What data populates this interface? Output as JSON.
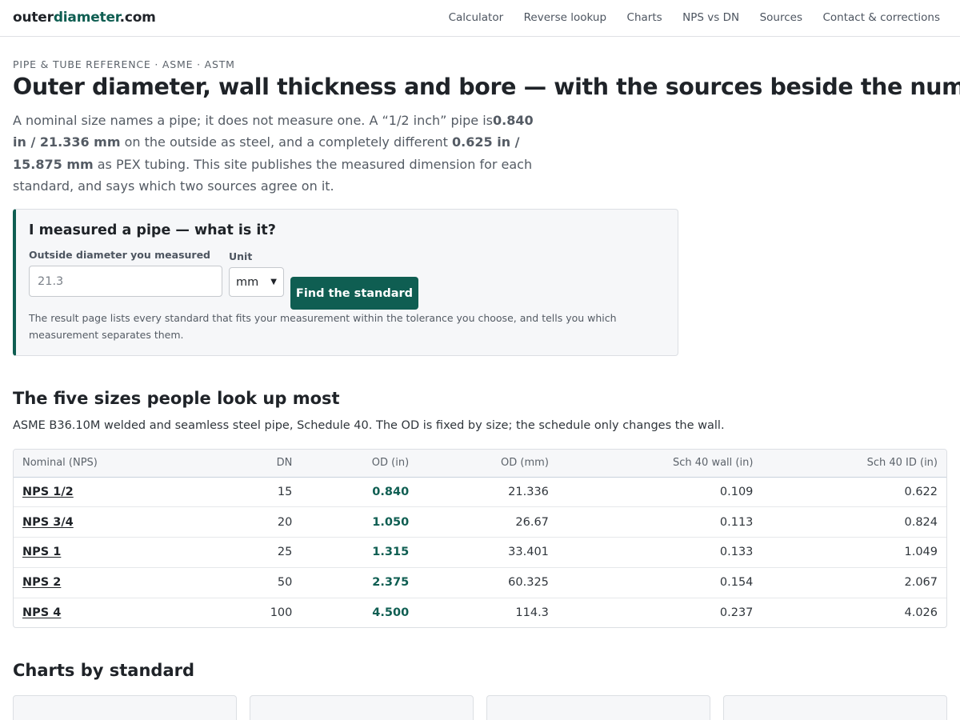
{
  "header": {
    "logo_part1": "outer",
    "logo_part2": "diameter",
    "logo_part3": ".com",
    "nav": [
      "Calculator",
      "Reverse lookup",
      "Charts",
      "NPS vs DN",
      "Sources",
      "Contact & corrections"
    ]
  },
  "intro": {
    "eyebrow": "PIPE & TUBE REFERENCE · ASME · ASTM",
    "title": "Outer diameter, wall thickness and bore — with the sources beside the number",
    "lead_1": "A nominal size names a pipe; it does not measure one. A “1/2 inch” pipe is",
    "lead_b1": "0.840 in / 21.336 mm",
    "lead_2": " on the outside as steel, and a completely different ",
    "lead_b2": "0.625 in / 15.875 mm",
    "lead_3": " as PEX tubing. This site publishes the measured dimension for each standard, and says which two sources agree on it."
  },
  "lookup": {
    "title": "I measured a pipe — what is it?",
    "od_label": "Outside diameter you measured",
    "od_placeholder": "21.3",
    "unit_label": "Unit",
    "unit_value": "mm",
    "button": "Find the standard",
    "help": "The result page lists every standard that fits your measurement within the tolerance you choose, and tells you which measurement separates them."
  },
  "sizes": {
    "heading": "The five sizes people look up most",
    "subtitle": "ASME B36.10M welded and seamless steel pipe, Schedule 40. The OD is fixed by size; the schedule only changes the wall.",
    "columns": [
      "Nominal (NPS)",
      "DN",
      "OD (in)",
      "OD (mm)",
      "Sch 40 wall (in)",
      "Sch 40 ID (in)"
    ],
    "rows": [
      [
        "NPS 1/2",
        "15",
        "0.840",
        "21.336",
        "0.109",
        "0.622"
      ],
      [
        "NPS 3/4",
        "20",
        "1.050",
        "26.67",
        "0.113",
        "0.824"
      ],
      [
        "NPS 1",
        "25",
        "1.315",
        "33.401",
        "0.133",
        "1.049"
      ],
      [
        "NPS 2",
        "50",
        "2.375",
        "60.325",
        "0.154",
        "2.067"
      ],
      [
        "NPS 4",
        "100",
        "4.500",
        "114.3",
        "0.237",
        "4.026"
      ]
    ]
  },
  "charts": {
    "heading": "Charts by standard"
  },
  "colors": {
    "accent": "#0f5e52",
    "panel_bg": "#f6f7f9"
  }
}
